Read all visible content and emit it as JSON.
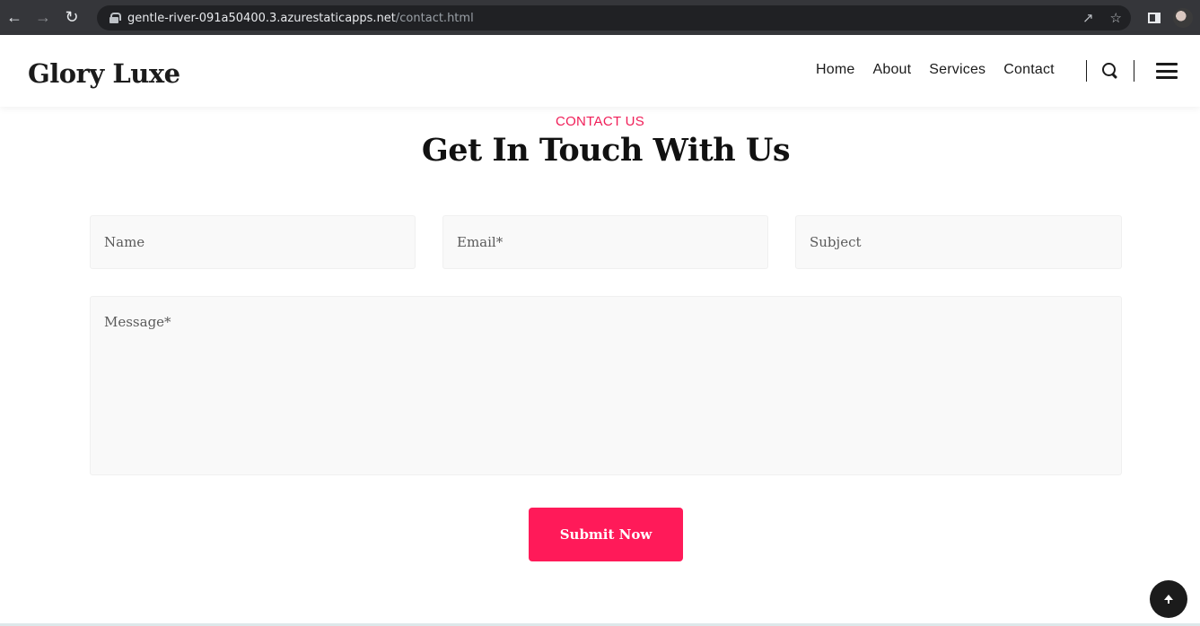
{
  "browser": {
    "url_host": "gentle-river-091a50400.3.azurestaticapps.net",
    "url_path": "/contact.html",
    "icons": [
      "back-arrow-icon",
      "forward-arrow-icon",
      "reload-icon",
      "lock-icon",
      "share-icon",
      "star-icon",
      "side-panel-icon",
      "profile-avatar"
    ]
  },
  "header": {
    "logo": "Glory Luxe",
    "nav": [
      "Home",
      "About",
      "Services",
      "Contact"
    ]
  },
  "contact": {
    "kicker": "CONTACT US",
    "title": "Get In Touch With Us",
    "fields": {
      "name_placeholder": "Name",
      "email_placeholder": "Email*",
      "subject_placeholder": "Subject",
      "message_placeholder": "Message*"
    },
    "submit_label": "Submit Now"
  },
  "colors": {
    "accent": "#ff1a59",
    "kicker": "#f01e58",
    "field_bg": "#f9f9f9",
    "text_dark": "#1b1b1b"
  }
}
